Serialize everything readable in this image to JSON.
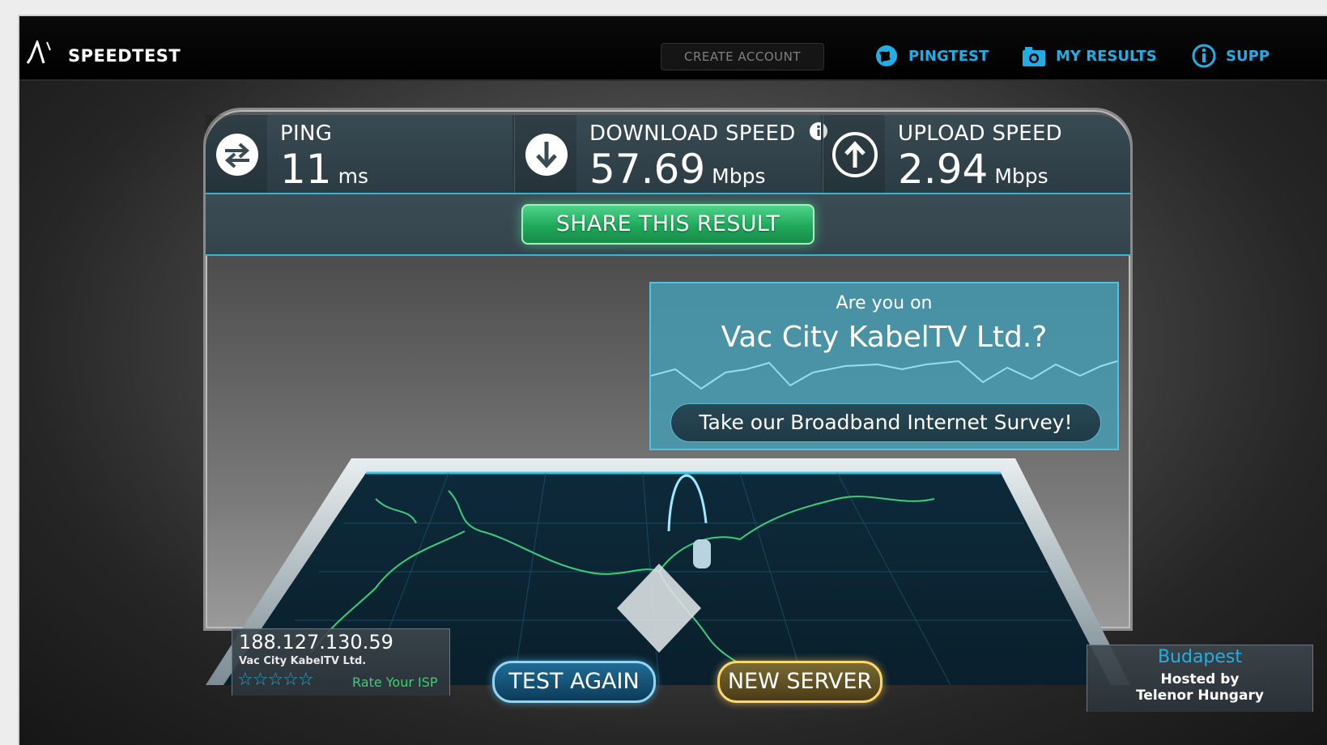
{
  "header": {
    "logo_text": "SPEEDTEST",
    "create_account_label": "CREATE ACCOUNT",
    "nav": [
      {
        "label": "PINGTEST",
        "icon": "globe-icon"
      },
      {
        "label": "MY RESULTS",
        "icon": "camera-icon"
      },
      {
        "label": "SUPP",
        "icon": "info-icon"
      }
    ]
  },
  "stats": {
    "ping": {
      "label": "PING",
      "value": "11",
      "unit": "ms",
      "icon": "swap-arrows-icon"
    },
    "download": {
      "label": "DOWNLOAD SPEED",
      "value": "57.69",
      "unit": "Mbps",
      "icon": "download-arrow-icon",
      "info_icon": "info-icon"
    },
    "upload": {
      "label": "UPLOAD SPEED",
      "value": "2.94",
      "unit": "Mbps",
      "icon": "upload-arrow-icon"
    }
  },
  "share_label": "SHARE THIS RESULT",
  "survey": {
    "prefix": "Are you on",
    "isp_question": "Vac City KabelTV Ltd.?",
    "button_label": "Take our Broadband Internet Survey!"
  },
  "client": {
    "ip": "188.127.130.59",
    "isp": "Vac City KabelTV Ltd.",
    "stars": "☆☆☆☆☆",
    "rate_label": "Rate Your ISP"
  },
  "buttons": {
    "test_again": "TEST AGAIN",
    "new_server": "NEW SERVER"
  },
  "server": {
    "city": "Budapest",
    "hosted_line1": "Hosted by",
    "hosted_line2": "Telenor Hungary"
  },
  "colors": {
    "accent_blue": "#22aee5",
    "share_green": "#2cc06d",
    "new_server_gold": "#ffd66a"
  }
}
